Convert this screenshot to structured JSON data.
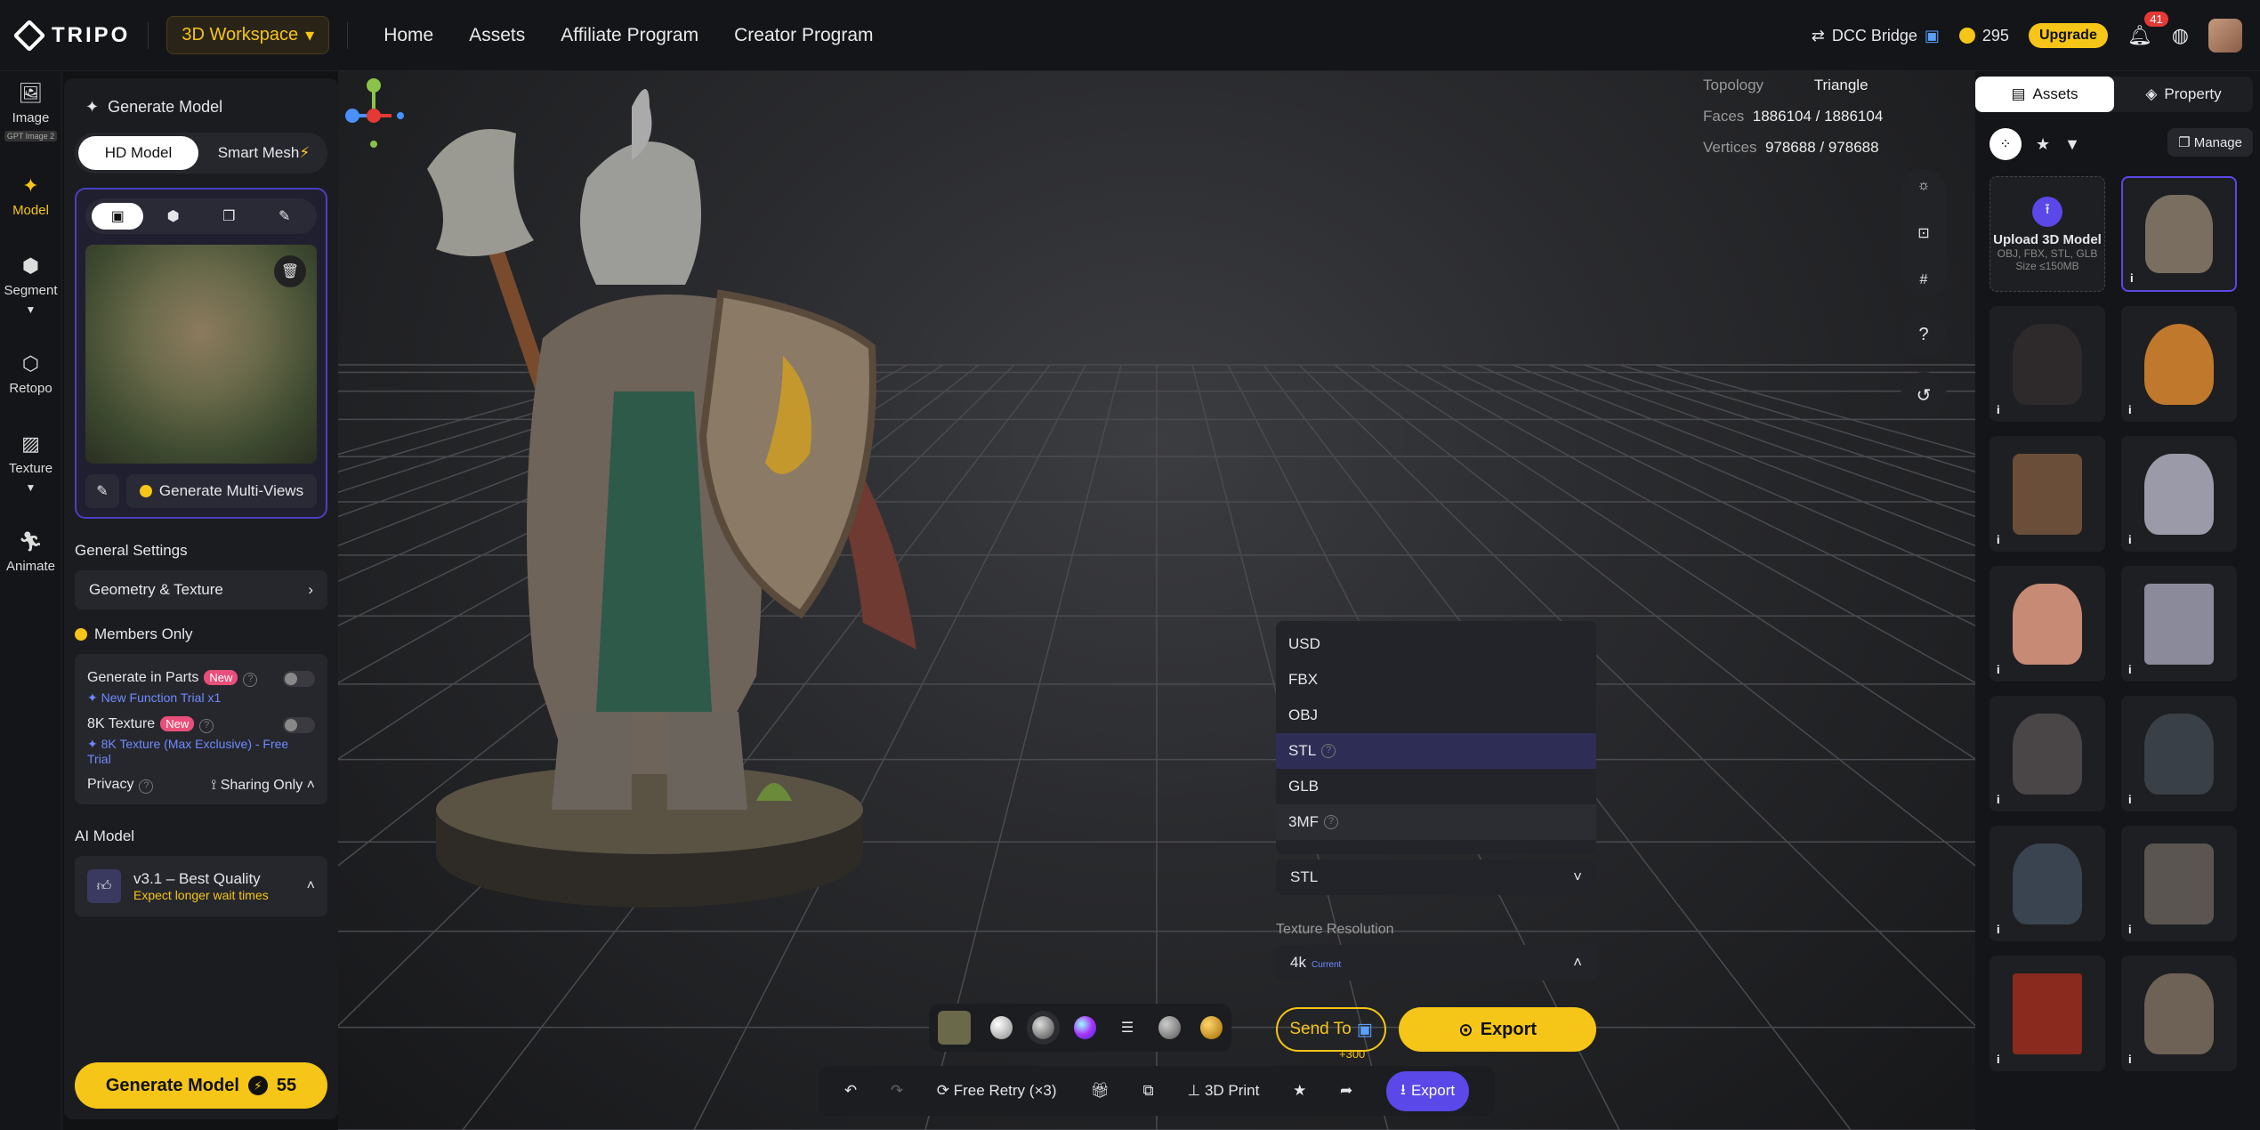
{
  "topbar": {
    "logo": "TRIPO",
    "workspace": "3D Workspace",
    "nav": [
      "Home",
      "Assets",
      "Affiliate Program",
      "Creator Program"
    ],
    "dcc_bridge": "DCC Bridge",
    "credits": "295",
    "upgrade": "Upgrade",
    "notifications": "41"
  },
  "rail": {
    "image": "Image",
    "gpt_tag": "GPT Image 2",
    "model": "Model",
    "segment": "Segment",
    "retopo": "Retopo",
    "texture": "Texture",
    "animate": "Animate"
  },
  "panel": {
    "title": "Generate Model",
    "mode_hd": "HD Model",
    "mode_smart": "Smart Mesh",
    "generate_multiviews": "Generate Multi-Views",
    "general_settings": "General Settings",
    "geometry_texture": "Geometry & Texture",
    "members_only": "Members Only",
    "gen_in_parts": "Generate in Parts",
    "new_badge": "New",
    "parts_trial": "New Function Trial x1",
    "texture_8k": "8K Texture",
    "texture_trial": "8K Texture (Max Exclusive) - Free Trial",
    "privacy": "Privacy",
    "sharing": "Sharing Only",
    "ai_model_title": "AI Model",
    "ai_model_name": "v3.1 – Best Quality",
    "ai_model_sub": "Expect longer wait times",
    "generate_button": "Generate Model",
    "generate_cost": "55"
  },
  "viewport": {
    "topology_label": "Topology",
    "topology_value": "Triangle",
    "faces_label": "Faces",
    "faces_value": "1886104 / 1886104",
    "vertices_label": "Vertices",
    "vertices_value": "978688 / 978688",
    "help": "?"
  },
  "export": {
    "formats": [
      "USD",
      "FBX",
      "OBJ",
      "STL",
      "GLB",
      "3MF"
    ],
    "selected_format": "STL",
    "texture_res_label": "Texture Resolution",
    "texture_res_value": "4k",
    "texture_res_tag": "Current",
    "send_to": "Send To",
    "export_button": "Export"
  },
  "bottombar": {
    "free_retry": "Free Retry (×3)",
    "print": "3D Print",
    "export": "Export",
    "plus": "+300"
  },
  "rightpanel": {
    "tab_assets": "Assets",
    "tab_property": "Property",
    "manage": "Manage",
    "upload_title": "Upload 3D Model",
    "upload_formats": "OBJ, FBX, STL, GLB",
    "upload_size": "Size ≤150MB",
    "info": "i"
  },
  "colors": {
    "accent": "#f5c518",
    "primary": "#5a48e8",
    "panel": "#1b1c20"
  }
}
